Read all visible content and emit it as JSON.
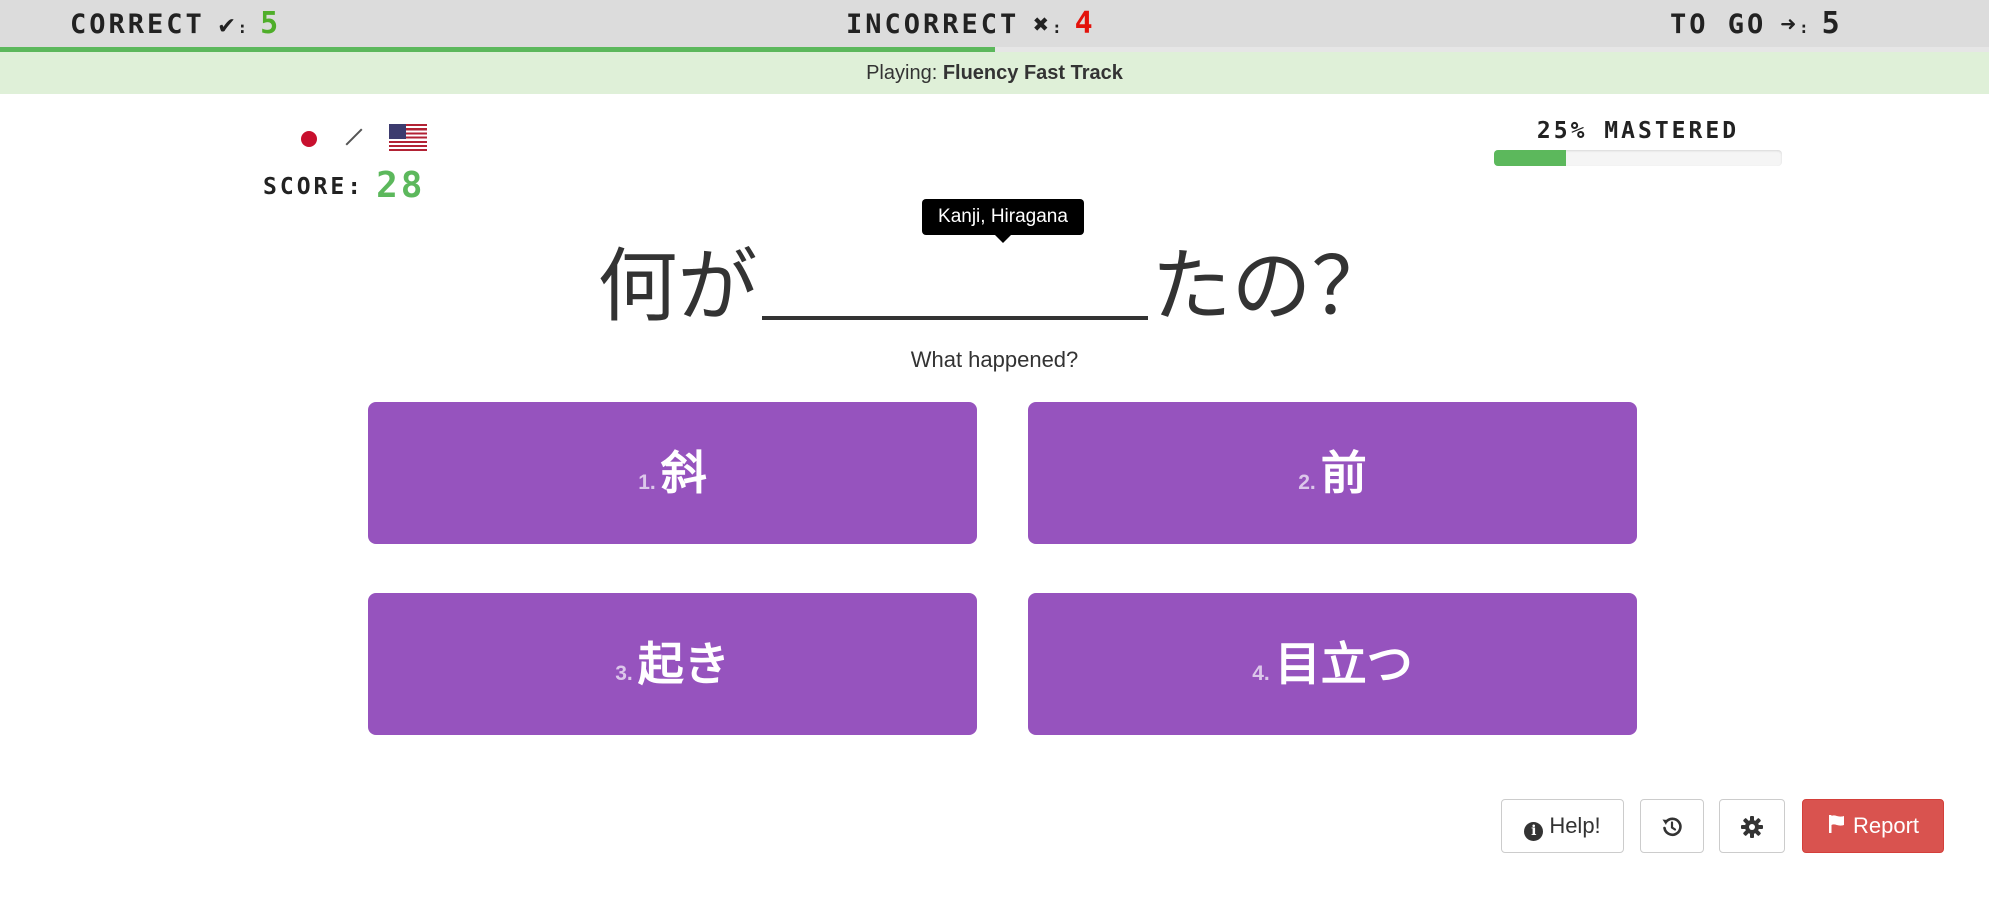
{
  "stats": {
    "correct_label": "CORRECT",
    "correct_symbol": "✔",
    "correct_value": "5",
    "incorrect_label": "INCORRECT",
    "incorrect_symbol": "✖",
    "incorrect_value": "4",
    "togo_label": "TO GO",
    "togo_symbol": "➜",
    "togo_value": "5",
    "colon": ":",
    "session_progress": 0.5
  },
  "banner": {
    "prefix": "Playing:",
    "deck": "Fluency Fast Track"
  },
  "languages": {
    "from": "flag-japan-icon",
    "to": "flag-usa-icon"
  },
  "score": {
    "label": "SCORE:",
    "value": "28"
  },
  "mastery": {
    "label": "25% MASTERED",
    "percent": 25
  },
  "tooltip": {
    "text": "Kanji, Hiragana"
  },
  "question": {
    "before": "何が",
    "after": "たの？",
    "translation": "What happened?"
  },
  "answers": [
    {
      "index": "1.",
      "text": "斜"
    },
    {
      "index": "2.",
      "text": "前"
    },
    {
      "index": "3.",
      "text": "起き"
    },
    {
      "index": "4.",
      "text": "目立つ"
    }
  ],
  "controls": {
    "help_label": "Help!",
    "report_label": "Report"
  },
  "colors": {
    "answer_bg": "#9653be",
    "correct": "#4fae2a",
    "incorrect": "#e3120b",
    "progress": "#5cb85c",
    "report": "#d9534f"
  }
}
